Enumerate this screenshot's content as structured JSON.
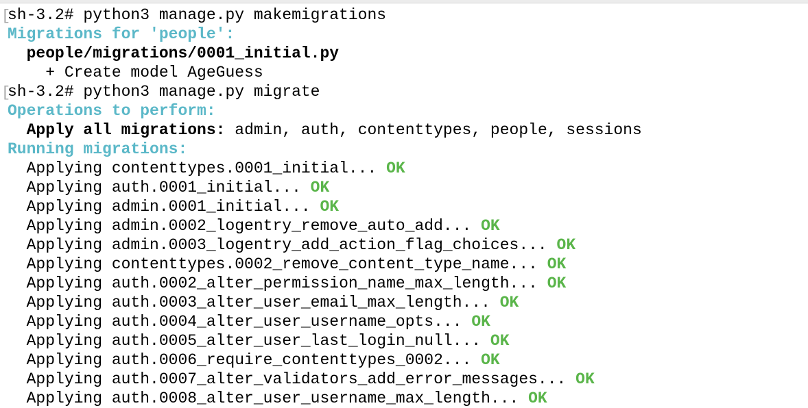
{
  "colors": {
    "heading": "#5bb8c8",
    "ok": "#5ab54a",
    "text": "#000000"
  },
  "lines": [
    {
      "prompt": true,
      "segments": [
        {
          "text": "sh-3.2# python3 manage.py makemigrations",
          "style": ""
        }
      ]
    },
    {
      "segments": [
        {
          "text": "Migrations for 'people':",
          "style": "cyan"
        }
      ]
    },
    {
      "segments": [
        {
          "text": "  ",
          "style": ""
        },
        {
          "text": "people/migrations/0001_initial.py",
          "style": "bold"
        }
      ]
    },
    {
      "segments": [
        {
          "text": "    + Create model AgeGuess",
          "style": ""
        }
      ]
    },
    {
      "prompt": true,
      "segments": [
        {
          "text": "sh-3.2# python3 manage.py migrate",
          "style": ""
        }
      ]
    },
    {
      "segments": [
        {
          "text": "Operations to perform:",
          "style": "cyan"
        }
      ]
    },
    {
      "segments": [
        {
          "text": "  ",
          "style": ""
        },
        {
          "text": "Apply all migrations:",
          "style": "bold"
        },
        {
          "text": " admin, auth, contenttypes, people, sessions",
          "style": ""
        }
      ]
    },
    {
      "segments": [
        {
          "text": "Running migrations:",
          "style": "cyan"
        }
      ]
    },
    {
      "segments": [
        {
          "text": "  Applying contenttypes.0001_initial... ",
          "style": ""
        },
        {
          "text": "OK",
          "style": "green"
        }
      ]
    },
    {
      "segments": [
        {
          "text": "  Applying auth.0001_initial... ",
          "style": ""
        },
        {
          "text": "OK",
          "style": "green"
        }
      ]
    },
    {
      "segments": [
        {
          "text": "  Applying admin.0001_initial... ",
          "style": ""
        },
        {
          "text": "OK",
          "style": "green"
        }
      ]
    },
    {
      "segments": [
        {
          "text": "  Applying admin.0002_logentry_remove_auto_add... ",
          "style": ""
        },
        {
          "text": "OK",
          "style": "green"
        }
      ]
    },
    {
      "segments": [
        {
          "text": "  Applying admin.0003_logentry_add_action_flag_choices... ",
          "style": ""
        },
        {
          "text": "OK",
          "style": "green"
        }
      ]
    },
    {
      "segments": [
        {
          "text": "  Applying contenttypes.0002_remove_content_type_name... ",
          "style": ""
        },
        {
          "text": "OK",
          "style": "green"
        }
      ]
    },
    {
      "segments": [
        {
          "text": "  Applying auth.0002_alter_permission_name_max_length... ",
          "style": ""
        },
        {
          "text": "OK",
          "style": "green"
        }
      ]
    },
    {
      "segments": [
        {
          "text": "  Applying auth.0003_alter_user_email_max_length... ",
          "style": ""
        },
        {
          "text": "OK",
          "style": "green"
        }
      ]
    },
    {
      "segments": [
        {
          "text": "  Applying auth.0004_alter_user_username_opts... ",
          "style": ""
        },
        {
          "text": "OK",
          "style": "green"
        }
      ]
    },
    {
      "segments": [
        {
          "text": "  Applying auth.0005_alter_user_last_login_null... ",
          "style": ""
        },
        {
          "text": "OK",
          "style": "green"
        }
      ]
    },
    {
      "segments": [
        {
          "text": "  Applying auth.0006_require_contenttypes_0002... ",
          "style": ""
        },
        {
          "text": "OK",
          "style": "green"
        }
      ]
    },
    {
      "segments": [
        {
          "text": "  Applying auth.0007_alter_validators_add_error_messages... ",
          "style": ""
        },
        {
          "text": "OK",
          "style": "green"
        }
      ]
    },
    {
      "segments": [
        {
          "text": "  Applying auth.0008_alter_user_username_max_length... ",
          "style": ""
        },
        {
          "text": "OK",
          "style": "green"
        }
      ]
    }
  ]
}
